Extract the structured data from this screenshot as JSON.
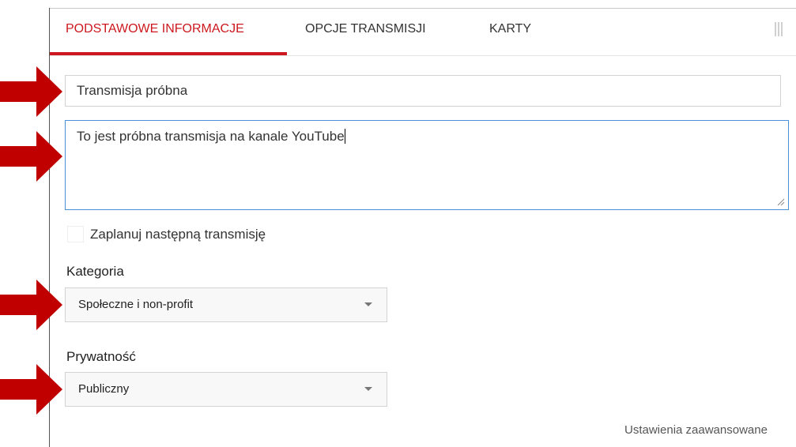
{
  "tabs": [
    {
      "label": "PODSTAWOWE INFORMACJE",
      "active": true
    },
    {
      "label": "OPCJE TRANSMISJI",
      "active": false
    },
    {
      "label": "KARTY",
      "active": false
    }
  ],
  "form": {
    "title_value": "Transmisja próbna",
    "description_value": "To jest próbna transmisja na kanale YouTube",
    "schedule_checkbox_label": "Zaplanuj następną transmisję",
    "schedule_checked": false,
    "category_label": "Kategoria",
    "category_value": "Społeczne i non-profit",
    "privacy_label": "Prywatność",
    "privacy_value": "Publiczny",
    "advanced_link": "Ustawienia zaawansowane"
  },
  "colors": {
    "accent": "#cc181e",
    "annotation_arrow": "#c00000",
    "focus_border": "#4a90d9"
  },
  "icons": {
    "dropdown": "caret-down-icon",
    "grip": "drag-grip-icon",
    "resize": "resize-handle-icon",
    "annotation": "arrow-right-icon"
  }
}
